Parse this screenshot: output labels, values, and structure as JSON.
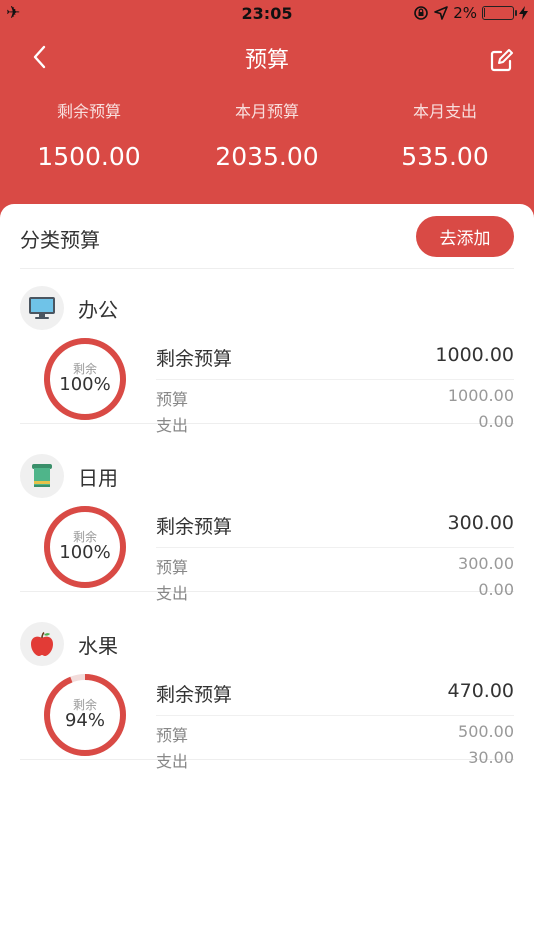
{
  "status_bar": {
    "time": "23:05",
    "battery": "2%"
  },
  "nav": {
    "title": "预算"
  },
  "summary": [
    {
      "label": "剩余预算",
      "value": "1500.00"
    },
    {
      "label": "本月预算",
      "value": "2035.00"
    },
    {
      "label": "本月支出",
      "value": "535.00"
    }
  ],
  "section": {
    "title": "分类预算",
    "add_label": "去添加"
  },
  "colors": {
    "accent": "#D94A45"
  },
  "categories": [
    {
      "name": "办公",
      "icon": "monitor-icon",
      "ring_label": "剩余",
      "percent": "100%",
      "remaining_fraction": 1.0,
      "remain_label": "剩余预算",
      "remain_value": "1000.00",
      "budget_label": "预算",
      "budget_value": "1000.00",
      "spent_label": "支出",
      "spent_value": "0.00"
    },
    {
      "name": "日用",
      "icon": "towel-icon",
      "ring_label": "剩余",
      "percent": "100%",
      "remaining_fraction": 1.0,
      "remain_label": "剩余预算",
      "remain_value": "300.00",
      "budget_label": "预算",
      "budget_value": "300.00",
      "spent_label": "支出",
      "spent_value": "0.00"
    },
    {
      "name": "水果",
      "icon": "apple-icon",
      "ring_label": "剩余",
      "percent": "94%",
      "remaining_fraction": 0.94,
      "remain_label": "剩余预算",
      "remain_value": "470.00",
      "budget_label": "预算",
      "budget_value": "500.00",
      "spent_label": "支出",
      "spent_value": "30.00"
    }
  ]
}
